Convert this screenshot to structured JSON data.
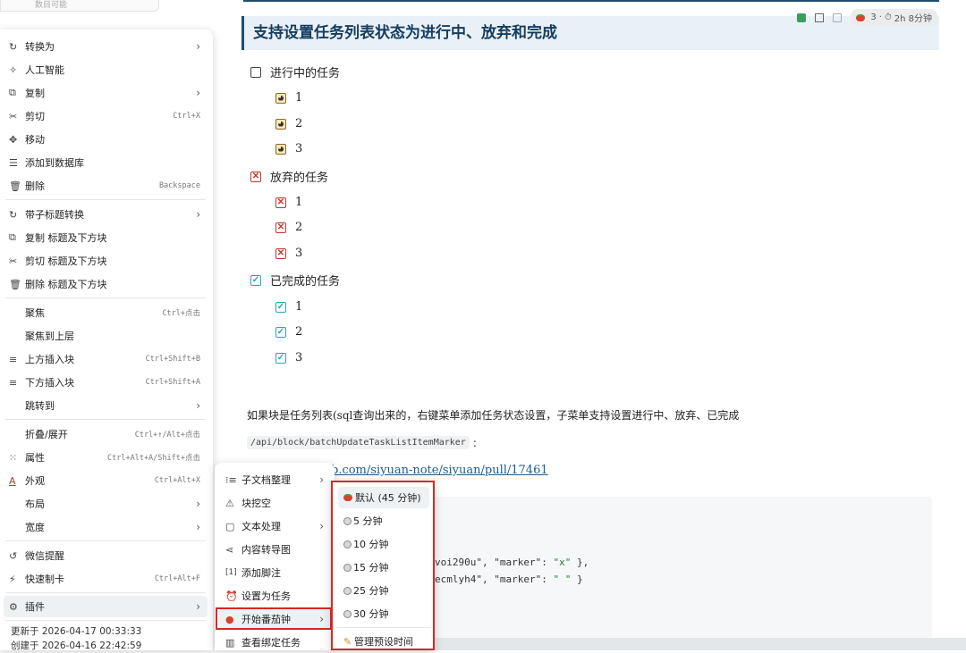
{
  "prev_item": "数目可能",
  "document": {
    "heading": "支持设置任务列表状态为进行中、放弃和完成",
    "status": {
      "pomodoro_count": "3",
      "time": "2h 8分钟"
    },
    "groups": [
      {
        "label": "进行中的任务",
        "items": [
          "1",
          "2",
          "3"
        ]
      },
      {
        "label": "放弃的任务",
        "items": [
          "1",
          "2",
          "3"
        ]
      },
      {
        "label": "已完成的任务",
        "items": [
          "1",
          "2",
          "3"
        ]
      }
    ],
    "paragraph": "如果块是任务列表(sql查询出来的，右键菜单添加任务状态设置，子菜单支持设置进行中、放弃、已完成",
    "api_path": "/api/block/batchUpdateTaskListItemMarker",
    "api_colon": ":",
    "link_text": "b.com/siyuan-note/siyuan/pull/17461",
    "code_lines": [
      {
        "pre": "voi290u\", \"marker\": ",
        "val": "\"x\"",
        "post": " },"
      },
      {
        "pre": "ecmlyh4\", \"marker\": ",
        "val": "\" \"",
        "post": " }"
      }
    ]
  },
  "context_menu": {
    "items": [
      {
        "icon": "↻",
        "label": "转换为",
        "arrow": "›"
      },
      {
        "icon": "✧",
        "label": "人工智能"
      },
      {
        "icon": "⧉",
        "label": "复制",
        "arrow": "›"
      },
      {
        "icon": "✂",
        "label": "剪切",
        "shortcut": "Ctrl+X"
      },
      {
        "icon": "✥",
        "label": "移动"
      },
      {
        "icon": "☰",
        "label": "添加到数据库"
      },
      {
        "icon": "🗑",
        "label": "删除",
        "shortcut": "Backspace"
      },
      {
        "icon": "↻",
        "label": "带子标题转换",
        "arrow": "›"
      },
      {
        "icon": "⧉",
        "label": "复制 标题及下方块"
      },
      {
        "icon": "✂",
        "label": "剪切 标题及下方块"
      },
      {
        "icon": "🗑",
        "label": "删除 标题及下方块"
      },
      {
        "icon": "",
        "label": "聚焦",
        "shortcut": "Ctrl+点击"
      },
      {
        "icon": "",
        "label": "聚焦到上层"
      },
      {
        "icon": "≡",
        "label": "上方插入块",
        "shortcut": "Ctrl+Shift+B"
      },
      {
        "icon": "≡",
        "label": "下方插入块",
        "shortcut": "Ctrl+Shift+A"
      },
      {
        "icon": "",
        "label": "跳转到",
        "arrow": "›"
      },
      {
        "icon": "",
        "label": "折叠/展开",
        "shortcut": "Ctrl+↑/Alt+点击"
      },
      {
        "icon": "⁙",
        "label": "属性",
        "shortcut": "Ctrl+Alt+A/Shift+点击"
      },
      {
        "icon": "A",
        "label": "外观",
        "shortcut": "Ctrl+Alt+X"
      },
      {
        "icon": "",
        "label": "布局",
        "arrow": "›"
      },
      {
        "icon": "",
        "label": "宽度",
        "arrow": "›"
      },
      {
        "icon": "↺",
        "label": "微信提醒"
      },
      {
        "icon": "⚡",
        "label": "快速制卡",
        "shortcut": "Ctrl+Alt+F"
      },
      {
        "icon": "⚙",
        "label": "插件",
        "arrow": "›"
      }
    ],
    "updated": "更新于 2026-04-17 00:33:33",
    "created": "创建于 2026-04-16 22:42:59"
  },
  "plugin_menu": {
    "items": [
      {
        "icon": "⁝≡",
        "label": "子文档整理",
        "arrow": "›"
      },
      {
        "icon": "⚠",
        "label": "块挖空"
      },
      {
        "icon": "▢",
        "label": "文本处理",
        "arrow": "›"
      },
      {
        "icon": "⋖",
        "label": "内容转导图"
      },
      {
        "icon": "[1]",
        "label": "添加脚注"
      },
      {
        "icon": "⏰",
        "label": "设置为任务"
      },
      {
        "icon": "●",
        "label": "开始番茄钟",
        "arrow": "›"
      },
      {
        "icon": "▥",
        "label": "查看绑定任务"
      }
    ]
  },
  "pomodoro_menu": {
    "items": [
      {
        "label": "默认 (45 分钟)"
      },
      {
        "label": "5 分钟"
      },
      {
        "label": "10 分钟"
      },
      {
        "label": "15 分钟"
      },
      {
        "label": "25 分钟"
      },
      {
        "label": "30 分钟"
      },
      {
        "label": "管理预设时间"
      }
    ]
  }
}
